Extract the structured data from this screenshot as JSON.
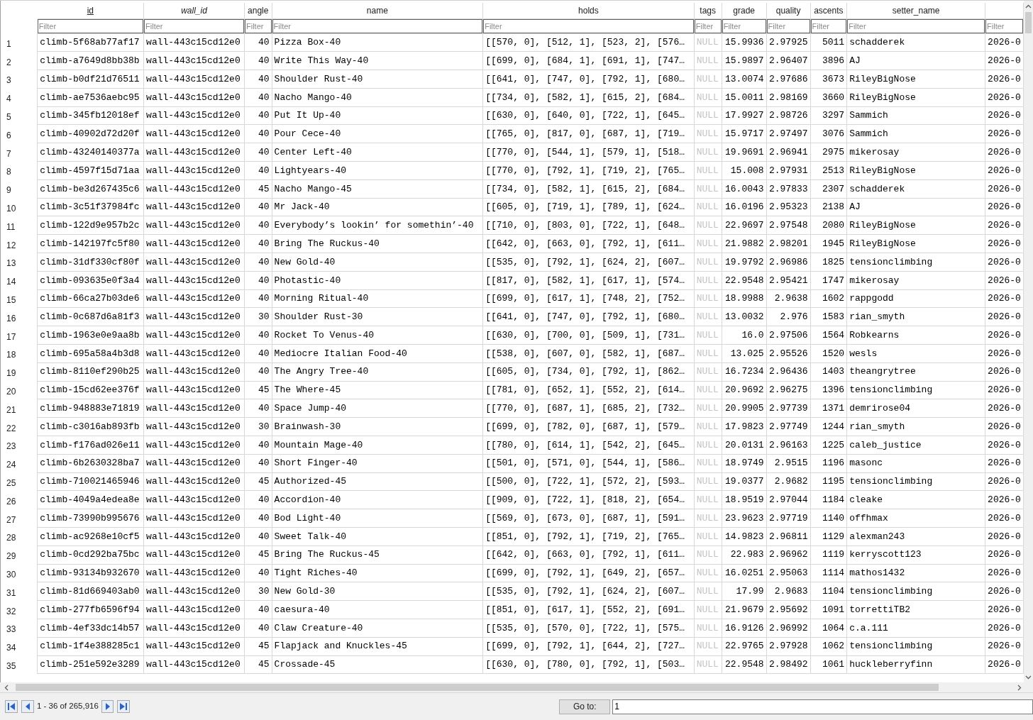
{
  "columns": [
    {
      "label": "id",
      "kind": "primary",
      "placeholder": "Filter"
    },
    {
      "label": "wall_id",
      "kind": "foreign",
      "placeholder": "Filter"
    },
    {
      "label": "angle",
      "kind": "number",
      "placeholder": "Filter"
    },
    {
      "label": "name",
      "kind": "text",
      "placeholder": "Filter"
    },
    {
      "label": "holds",
      "kind": "text",
      "placeholder": "Filter"
    },
    {
      "label": "tags",
      "kind": "null",
      "placeholder": "Filter"
    },
    {
      "label": "grade",
      "kind": "number",
      "placeholder": "Filter"
    },
    {
      "label": "quality",
      "kind": "number",
      "placeholder": "Filter"
    },
    {
      "label": "ascents",
      "kind": "number",
      "placeholder": "Filter"
    },
    {
      "label": "setter_name",
      "kind": "text",
      "placeholder": "Filter"
    },
    {
      "kind": "text",
      "placeholder": "Filter"
    }
  ],
  "rows": [
    {
      "number": "1",
      "cells": [
        "climb-5f68ab77af17",
        "wall-443c15cd12e0",
        "40",
        "Pizza Box-40",
        "[[570, 0], [512, 1], [523, 2], [576…",
        "NULL",
        "15.9936",
        "2.97925",
        "5011",
        "schadderek",
        "2026-0"
      ]
    },
    {
      "number": "2",
      "cells": [
        "climb-a7649d8bb38b",
        "wall-443c15cd12e0",
        "40",
        "Write This Way-40",
        "[[699, 0], [684, 1], [691, 1], [747…",
        "NULL",
        "15.9897",
        "2.96407",
        "3896",
        "AJ",
        "2026-0"
      ]
    },
    {
      "number": "3",
      "cells": [
        "climb-b0df21d76511",
        "wall-443c15cd12e0",
        "40",
        "Shoulder Rust-40",
        "[[641, 0], [747, 0], [792, 1], [680…",
        "NULL",
        "13.0074",
        "2.97686",
        "3673",
        "RileyBigNose",
        "2026-0"
      ]
    },
    {
      "number": "4",
      "cells": [
        "climb-ae7536aebc95",
        "wall-443c15cd12e0",
        "40",
        "Nacho Mango-40",
        "[[734, 0], [582, 1], [615, 2], [684…",
        "NULL",
        "15.0011",
        "2.98169",
        "3660",
        "RileyBigNose",
        "2026-0"
      ]
    },
    {
      "number": "5",
      "cells": [
        "climb-345fb12018ef",
        "wall-443c15cd12e0",
        "40",
        "Put It Up-40",
        "[[630, 0], [640, 0], [722, 1], [645…",
        "NULL",
        "17.9927",
        "2.98726",
        "3297",
        "Sammich",
        "2026-0"
      ]
    },
    {
      "number": "6",
      "cells": [
        "climb-40902d72d20f",
        "wall-443c15cd12e0",
        "40",
        "Pour Cece-40",
        "[[765, 0], [817, 0], [687, 1], [719…",
        "NULL",
        "15.9717",
        "2.97497",
        "3076",
        "Sammich",
        "2026-0"
      ]
    },
    {
      "number": "7",
      "cells": [
        "climb-43240140377a",
        "wall-443c15cd12e0",
        "40",
        "Center Left-40",
        "[[770, 0], [544, 1], [579, 1], [518…",
        "NULL",
        "19.9691",
        "2.96941",
        "2975",
        "mikerosay",
        "2026-0"
      ]
    },
    {
      "number": "8",
      "cells": [
        "climb-4597f15d71aa",
        "wall-443c15cd12e0",
        "40",
        "Lightyears-40",
        "[[770, 0], [792, 1], [719, 2], [765…",
        "NULL",
        "15.008",
        "2.97931",
        "2513",
        "RileyBigNose",
        "2026-0"
      ]
    },
    {
      "number": "9",
      "cells": [
        "climb-be3d267435c6",
        "wall-443c15cd12e0",
        "45",
        "Nacho Mango-45",
        "[[734, 0], [582, 1], [615, 2], [684…",
        "NULL",
        "16.0043",
        "2.97833",
        "2307",
        "schadderek",
        "2026-0"
      ]
    },
    {
      "number": "10",
      "cells": [
        "climb-3c51f37984fc",
        "wall-443c15cd12e0",
        "40",
        "Mr Jack-40",
        "[[605, 0], [719, 1], [789, 1], [624…",
        "NULL",
        "16.0196",
        "2.95323",
        "2138",
        "AJ",
        "2026-0"
      ]
    },
    {
      "number": "11",
      "cells": [
        "climb-122d9e957b2c",
        "wall-443c15cd12e0",
        "40",
        "Everybody’s lookin’ for somethin’-40",
        "[[710, 0], [803, 0], [722, 1], [648…",
        "NULL",
        "22.9697",
        "2.97548",
        "2080",
        "RileyBigNose",
        "2026-0"
      ]
    },
    {
      "number": "12",
      "cells": [
        "climb-142197fc5f80",
        "wall-443c15cd12e0",
        "40",
        "Bring The Ruckus-40",
        "[[642, 0], [663, 0], [792, 1], [611…",
        "NULL",
        "21.9882",
        "2.98201",
        "1945",
        "RileyBigNose",
        "2026-0"
      ]
    },
    {
      "number": "13",
      "cells": [
        "climb-31df330cf80f",
        "wall-443c15cd12e0",
        "40",
        "New Gold-40",
        "[[535, 0], [792, 1], [624, 2], [607…",
        "NULL",
        "19.9792",
        "2.96986",
        "1825",
        "tensionclimbing",
        "2026-0"
      ]
    },
    {
      "number": "14",
      "cells": [
        "climb-093635e0f3a4",
        "wall-443c15cd12e0",
        "40",
        "Photastic-40",
        "[[817, 0], [582, 1], [617, 1], [574…",
        "NULL",
        "22.9548",
        "2.95421",
        "1747",
        "mikerosay",
        "2026-0"
      ]
    },
    {
      "number": "15",
      "cells": [
        "climb-66ca27b03de6",
        "wall-443c15cd12e0",
        "40",
        "Morning Ritual-40",
        "[[699, 0], [617, 1], [748, 2], [752…",
        "NULL",
        "18.9988",
        "2.9638",
        "1602",
        "rappgodd",
        "2026-0"
      ]
    },
    {
      "number": "16",
      "cells": [
        "climb-0c687d6a81f3",
        "wall-443c15cd12e0",
        "30",
        "Shoulder Rust-30",
        "[[641, 0], [747, 0], [792, 1], [680…",
        "NULL",
        "13.0032",
        "2.976",
        "1583",
        "rian_smyth",
        "2026-0"
      ]
    },
    {
      "number": "17",
      "cells": [
        "climb-1963e0e9aa8b",
        "wall-443c15cd12e0",
        "40",
        "Rocket To Venus-40",
        "[[630, 0], [700, 0], [509, 1], [731…",
        "NULL",
        "16.0",
        "2.97506",
        "1564",
        "Robkearns",
        "2026-0"
      ]
    },
    {
      "number": "18",
      "cells": [
        "climb-695a58a4b3d8",
        "wall-443c15cd12e0",
        "40",
        "Mediocre Italian Food-40",
        "[[538, 0], [607, 0], [582, 1], [687…",
        "NULL",
        "13.025",
        "2.95526",
        "1520",
        "wesls",
        "2026-0"
      ]
    },
    {
      "number": "19",
      "cells": [
        "climb-8110ef290b25",
        "wall-443c15cd12e0",
        "40",
        "The Angry Tree-40",
        "[[605, 0], [734, 0], [792, 1], [862…",
        "NULL",
        "16.7234",
        "2.96436",
        "1403",
        "theangrytree",
        "2026-0"
      ]
    },
    {
      "number": "20",
      "cells": [
        "climb-15cd62ee376f",
        "wall-443c15cd12e0",
        "45",
        "The Where-45",
        "[[781, 0], [652, 1], [552, 2], [614…",
        "NULL",
        "20.9692",
        "2.96275",
        "1396",
        "tensionclimbing",
        "2026-0"
      ]
    },
    {
      "number": "21",
      "cells": [
        "climb-948883e71819",
        "wall-443c15cd12e0",
        "40",
        "Space Jump-40",
        "[[770, 0], [687, 1], [685, 2], [732…",
        "NULL",
        "20.9905",
        "2.97739",
        "1371",
        "demrirose04",
        "2026-0"
      ]
    },
    {
      "number": "22",
      "cells": [
        "climb-c3016ab893fb",
        "wall-443c15cd12e0",
        "30",
        "Brainwash-30",
        "[[699, 0], [782, 0], [687, 1], [579…",
        "NULL",
        "17.9823",
        "2.97749",
        "1244",
        "rian_smyth",
        "2026-0"
      ]
    },
    {
      "number": "23",
      "cells": [
        "climb-f176ad026e11",
        "wall-443c15cd12e0",
        "40",
        "Mountain Mage-40",
        "[[780, 0], [614, 1], [542, 2], [645…",
        "NULL",
        "20.0131",
        "2.96163",
        "1225",
        "caleb_justice",
        "2026-0"
      ]
    },
    {
      "number": "24",
      "cells": [
        "climb-6b2630328ba7",
        "wall-443c15cd12e0",
        "40",
        "Short Finger-40",
        "[[501, 0], [571, 0], [544, 1], [586…",
        "NULL",
        "18.9749",
        "2.9515",
        "1196",
        "masonc",
        "2026-0"
      ]
    },
    {
      "number": "25",
      "cells": [
        "climb-710021465946",
        "wall-443c15cd12e0",
        "45",
        "Authorized-45",
        "[[500, 0], [722, 1], [572, 2], [593…",
        "NULL",
        "19.0377",
        "2.9682",
        "1195",
        "tensionclimbing",
        "2026-0"
      ]
    },
    {
      "number": "26",
      "cells": [
        "climb-4049a4edea8e",
        "wall-443c15cd12e0",
        "40",
        "Accordion-40",
        "[[909, 0], [722, 1], [818, 2], [654…",
        "NULL",
        "18.9519",
        "2.97044",
        "1184",
        "cleake",
        "2026-0"
      ]
    },
    {
      "number": "27",
      "cells": [
        "climb-73990b995676",
        "wall-443c15cd12e0",
        "40",
        "Bod Light-40",
        "[[569, 0], [673, 0], [687, 1], [591…",
        "NULL",
        "23.9623",
        "2.97719",
        "1140",
        "offhmax",
        "2026-0"
      ]
    },
    {
      "number": "28",
      "cells": [
        "climb-ac9268e10cf5",
        "wall-443c15cd12e0",
        "40",
        "Sweet Talk-40",
        "[[851, 0], [792, 1], [719, 2], [765…",
        "NULL",
        "14.9823",
        "2.96811",
        "1129",
        "alexman243",
        "2026-0"
      ]
    },
    {
      "number": "29",
      "cells": [
        "climb-0cd292ba75bc",
        "wall-443c15cd12e0",
        "45",
        "Bring The Ruckus-45",
        "[[642, 0], [663, 0], [792, 1], [611…",
        "NULL",
        "22.983",
        "2.96962",
        "1119",
        "kerryscott123",
        "2026-0"
      ]
    },
    {
      "number": "30",
      "cells": [
        "climb-93134b932670",
        "wall-443c15cd12e0",
        "40",
        "Tight Riches-40",
        "[[699, 0], [792, 1], [649, 2], [657…",
        "NULL",
        "16.0251",
        "2.95063",
        "1114",
        "mathos1432",
        "2026-0"
      ]
    },
    {
      "number": "31",
      "cells": [
        "climb-81d669403ab0",
        "wall-443c15cd12e0",
        "30",
        "New Gold-30",
        "[[535, 0], [792, 1], [624, 2], [607…",
        "NULL",
        "17.99",
        "2.9683",
        "1104",
        "tensionclimbing",
        "2026-0"
      ]
    },
    {
      "number": "32",
      "cells": [
        "climb-277fb6596f94",
        "wall-443c15cd12e0",
        "40",
        "caesura-40",
        "[[851, 0], [617, 1], [552, 2], [691…",
        "NULL",
        "21.9679",
        "2.95692",
        "1091",
        "torrettiTB2",
        "2026-0"
      ]
    },
    {
      "number": "33",
      "cells": [
        "climb-4ef33dc14b57",
        "wall-443c15cd12e0",
        "40",
        "Claw Creature-40",
        "[[535, 0], [570, 0], [722, 1], [575…",
        "NULL",
        "16.9126",
        "2.96992",
        "1064",
        "c.a.111",
        "2026-0"
      ]
    },
    {
      "number": "34",
      "cells": [
        "climb-1f4e388285c1",
        "wall-443c15cd12e0",
        "45",
        "Flapjack and Knuckles-45",
        "[[699, 0], [792, 1], [644, 2], [727…",
        "NULL",
        "22.9765",
        "2.97928",
        "1062",
        "tensionclimbing",
        "2026-0"
      ]
    },
    {
      "number": "35",
      "cells": [
        "climb-251e592e3289",
        "wall-443c15cd12e0",
        "45",
        "Crossade-45",
        "[[630, 0], [780, 0], [792, 1], [503…",
        "NULL",
        "22.9548",
        "2.98492",
        "1061",
        "huckleberryfinn",
        "2026-0"
      ]
    }
  ],
  "footer": {
    "record_count": "1 - 36 of 265,916",
    "goto_label": "Go to:",
    "goto_value": "1"
  }
}
